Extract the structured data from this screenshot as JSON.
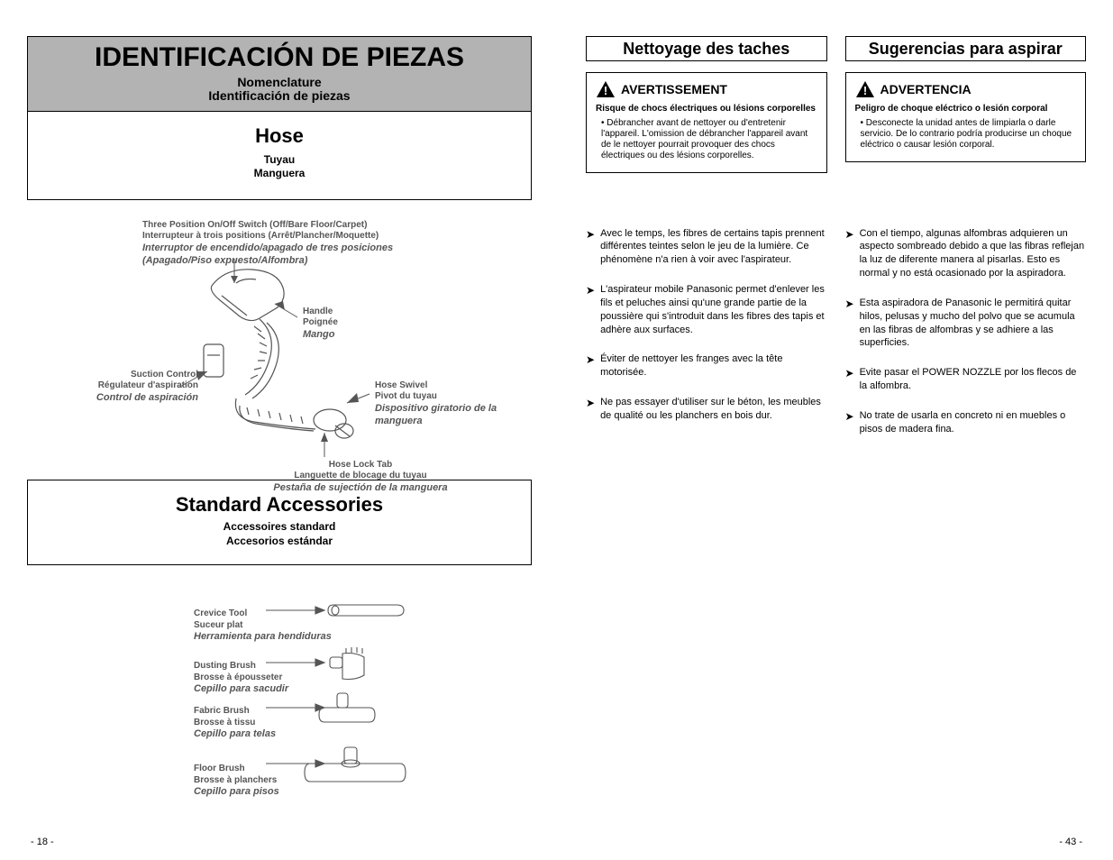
{
  "left": {
    "gray_title": "IDENTIFICACIÓN DE PIEZAS",
    "gray_sub": "Nomenclature\nIdentificación de piezas",
    "hose_box_en": "Hose",
    "hose_box_sub": "Tuyau\nManguera",
    "std_box_en": "Standard Accessories",
    "std_box_sub": "Accessoires standard\nAccesorios estándar",
    "hose_labels": {
      "switch_en_1": "Three Position On/Off Switch (Off/Bare Floor/Carpet)",
      "switch_en_2": "Interrupteur à trois positions (Arrêt/Plancher/Moquette)",
      "switch_es": "Interruptor de encendido/apagado de tres posiciones (Apagado/Piso expuesto/Alfombra)",
      "handle_en": "Handle",
      "handle_fr": "Poignée",
      "handle_es": "Mango",
      "suction_en": "Suction Control",
      "suction_fr": "Régulateur d'aspiration",
      "suction_es": "Control de aspiración",
      "swivel_en": "Hose Swivel",
      "swivel_fr": "Pivot du tuyau",
      "swivel_es": "Dispositivo giratorio de la manguera",
      "tab_en": "Hose Lock Tab",
      "tab_fr": "Languette de blocage du tuyau",
      "tab_es": "Pestaña de sujectión de la manguera"
    },
    "tools": {
      "crevice_en": "Crevice Tool",
      "crevice_fr": "Suceur plat",
      "crevice_es": "Herramienta para hendiduras",
      "dusting_en": "Dusting Brush",
      "dusting_fr": "Brosse à épousseter",
      "dusting_es": "Cepillo para sacudir",
      "fabric_en": "Fabric Brush",
      "fabric_fr": "Brosse à tissu",
      "fabric_es": "Cepillo para telas",
      "floor_en": "Floor Brush",
      "floor_fr": "Brosse à planchers",
      "floor_es": "Cepillo para pisos"
    }
  },
  "right": {
    "fr": {
      "heading_en": "Nettoyage des taches",
      "heading_sub": "",
      "warn_title": "AVERTISSEMENT",
      "warn_line": "Risque de chocs électriques ou lésions corporelles",
      "warn_b1": "• Débrancher avant de nettoyer ou d'entretenir l'appareil. L'omission de débrancher l'appareil avant de le nettoyer pourrait provoquer des chocs électriques ou des lésions corporelles.",
      "bullets": [
        "Avec le temps, les fibres de certains tapis prennent différentes teintes selon le jeu de la lumière. Ce phénomène n'a rien à voir avec l'aspirateur.",
        "L'aspirateur mobile Panasonic permet d'enlever les fils et peluches ainsi qu'une grande partie de la poussière qui s'introduit dans les fibres des tapis et adhère aux surfaces.",
        "Éviter de nettoyer les franges avec la tête motorisée.",
        "Ne pas essayer d'utiliser sur le béton, les meubles de qualité ou les planchers en bois dur."
      ]
    },
    "es": {
      "heading_en": "Sugerencias para aspirar",
      "heading_sub": "",
      "warn_title": "ADVERTENCIA",
      "warn_line": "Peligro de choque eléctrico o lesión corporal",
      "warn_b1": "• Desconecte la unidad antes de limpiarla o darle servicio. De lo contrario podría producirse un choque eléctrico o causar lesión corporal.",
      "bullets": [
        "Con el tiempo, algunas alfombras adquieren un aspecto sombreado debido a que las fibras reflejan la luz de diferente manera al pisarlas. Esto es normal y no está ocasionado por la aspiradora.",
        "Esta aspiradora de Panasonic le permitirá quitar hilos, pelusas y mucho del polvo que se acumula en las fibras de alfombras y se adhiere a las superficies.",
        "Evite pasar el POWER NOZZLE por los flecos de la alfombra.",
        "No trate de usarla en concreto ni en muebles o pisos de madera fina."
      ]
    }
  },
  "pages": {
    "left": "- 18 -",
    "right": "- 43 -"
  }
}
